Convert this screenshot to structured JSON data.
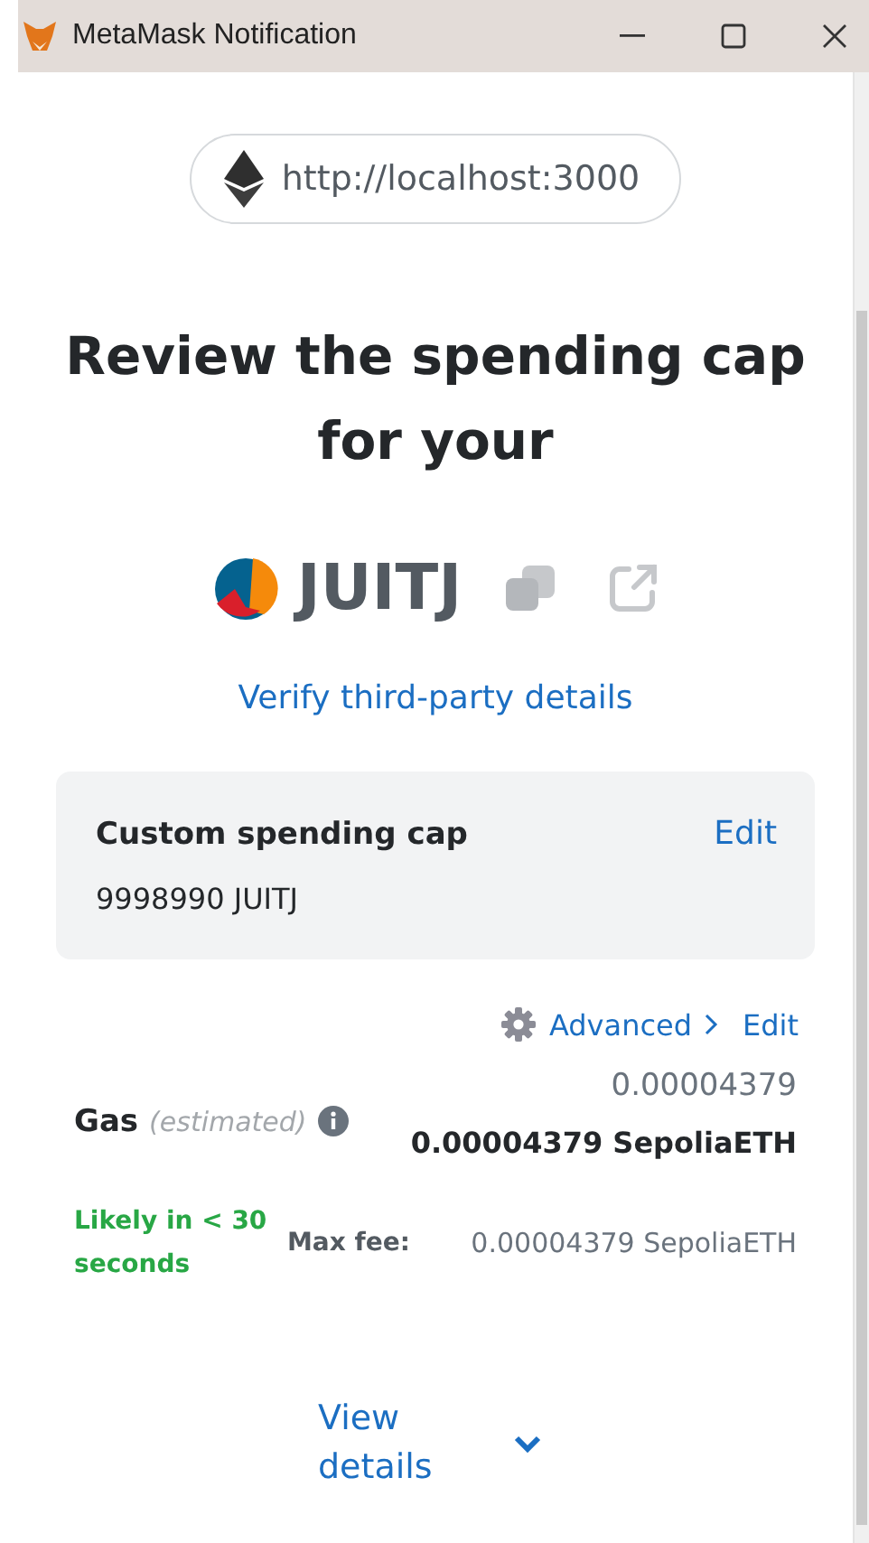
{
  "window": {
    "title": "MetaMask Notification"
  },
  "origin": "http://localhost:3000",
  "heading": "Review the spending cap for your",
  "token": {
    "symbol": "JUITJ"
  },
  "verify_link": "Verify third-party details",
  "spending_cap": {
    "label": "Custom spending cap",
    "edit": "Edit",
    "value": "9998990 JUITJ"
  },
  "gas": {
    "advanced": "Advanced",
    "edit": "Edit",
    "label": "Gas",
    "hint": "(estimated)",
    "amount": "0.00004379",
    "total": "0.00004379 SepoliaETH",
    "speed": "Likely in < 30 seconds",
    "max_fee_label": "Max fee:",
    "max_fee": "0.00004379 SepoliaETH"
  },
  "view_details": {
    "label": "View details",
    "expanded": false
  }
}
